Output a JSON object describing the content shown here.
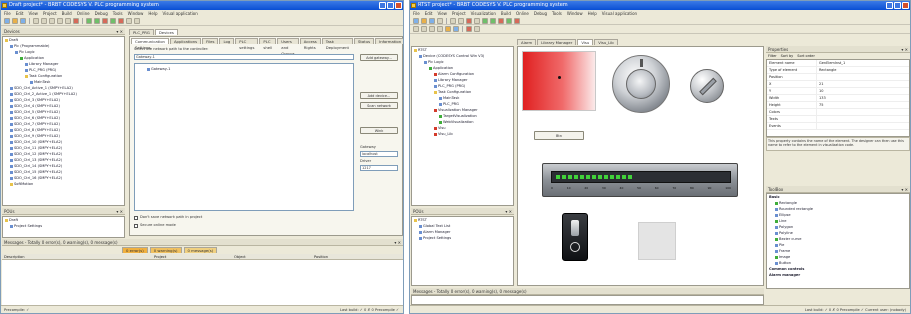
{
  "left_window": {
    "title": "Draft project* - BRBT CODESYS V. PLC programming system",
    "menu": [
      "File",
      "Edit",
      "View",
      "Project",
      "Build",
      "Online",
      "Debug",
      "Tools",
      "Window",
      "Help",
      "Visual application"
    ],
    "devices_pane": {
      "title": "Devices",
      "close": "▾ ✕"
    },
    "tree": [
      {
        "label": "Draft",
        "level": 0,
        "icon": "yellow"
      },
      {
        "label": "Plc (Programmable)",
        "level": 1,
        "icon": "blue"
      },
      {
        "label": "Plc Logic",
        "level": 2,
        "icon": "blue"
      },
      {
        "label": "Application",
        "level": 3,
        "icon": "green"
      },
      {
        "label": "Library Manager",
        "level": 4,
        "icon": "blue"
      },
      {
        "label": "PLC_PRG (PRG)",
        "level": 4,
        "icon": "blue"
      },
      {
        "label": "Task Configuration",
        "level": 4,
        "icon": "yellow"
      },
      {
        "label": "MainTask",
        "level": 5,
        "icon": "blue"
      },
      {
        "label": "SDO_Ctrl_Active_1 (SMPY+ELA2)",
        "level": 1,
        "icon": "blue"
      },
      {
        "label": "SDO_Ctrl_2_Active_1 (SMPY+ELA2)",
        "level": 1,
        "icon": "blue"
      },
      {
        "label": "SDO_Ctrl_3 (SMPY+ELA2)",
        "level": 1,
        "icon": "blue"
      },
      {
        "label": "SDO_Ctrl_4 (SMPY+ELA2)",
        "level": 1,
        "icon": "blue"
      },
      {
        "label": "SDO_Ctrl_5 (SMPY+ELA2)",
        "level": 1,
        "icon": "blue"
      },
      {
        "label": "SDO_Ctrl_6 (SMPY+ELA2)",
        "level": 1,
        "icon": "blue"
      },
      {
        "label": "SDO_Ctrl_7 (SMPY+ELA2)",
        "level": 1,
        "icon": "blue"
      },
      {
        "label": "SDO_Ctrl_8 (SMPY+ELA2)",
        "level": 1,
        "icon": "blue"
      },
      {
        "label": "SDO_Ctrl_9 (SMPY+ELA2)",
        "level": 1,
        "icon": "blue"
      },
      {
        "label": "SDO_Ctrl_10 (SMPY+ELA2)",
        "level": 1,
        "icon": "blue"
      },
      {
        "label": "SDO_Ctrl_11 (SMPY+ELA2)",
        "level": 1,
        "icon": "blue"
      },
      {
        "label": "SDO_Ctrl_12 (SMPY+ELA2)",
        "level": 1,
        "icon": "blue"
      },
      {
        "label": "SDO_Ctrl_13 (SMPY+ELA2)",
        "level": 1,
        "icon": "blue"
      },
      {
        "label": "SDO_Ctrl_14 (SMPY+ELA2)",
        "level": 1,
        "icon": "blue"
      },
      {
        "label": "SDO_Ctrl_15 (SMPY+ELA2)",
        "level": 1,
        "icon": "blue"
      },
      {
        "label": "SDO_Ctrl_16 (SMPY+ELA2)",
        "level": 1,
        "icon": "blue"
      },
      {
        "label": "SoftMotion",
        "level": 1,
        "icon": "yellow"
      }
    ],
    "pou_pane": {
      "title": "POUs",
      "items": [
        "Draft",
        "Project Settings"
      ]
    },
    "editor_tabs": [
      "PLC_PRG",
      "Devices"
    ],
    "sub_tabs": [
      "Communication Settings",
      "Applications",
      "Files",
      "Log",
      "PLC settings",
      "PLC shell",
      "Users and Groups",
      "Access Rights",
      "Task Deployment",
      "Status",
      "Information"
    ],
    "select_label": "Select the network path to the controller:",
    "gateway_value": "Gateway-1",
    "tree_node": "Gateway-1",
    "buttons": [
      "Add gateway...",
      "Add device...",
      "Scan network",
      "Wink"
    ],
    "right_labels": {
      "gateway": "Gateway",
      "ip": "localhost",
      "port": "1217",
      "driver": "Driver"
    },
    "checkboxes": [
      "Don't save network path in project",
      "Secure online mode"
    ],
    "messages": {
      "title": "Messages - Totally 0 error(s), 0 warning(s), 0 message(s)",
      "tabs": [
        "0 error(s)",
        "0 warning(s)",
        "0 message(s)"
      ],
      "columns": [
        "Description",
        "Project",
        "Object",
        "Position"
      ]
    },
    "status": {
      "left": "Precompile: ✓",
      "right": "Last build: ✓ 0 ✗ 0   Precompile ✓"
    }
  },
  "right_window": {
    "title": "RTST project* - BRBT CODESYS V. PLC programming system",
    "menu": [
      "File",
      "Edit",
      "View",
      "Project",
      "Visualization",
      "Build",
      "Online",
      "Debug",
      "Tools",
      "Window",
      "Help",
      "Visual application"
    ],
    "tree": [
      {
        "label": "RTST",
        "level": 0,
        "icon": "yellow"
      },
      {
        "label": "Device (CODESYS Control Win V3)",
        "level": 1,
        "icon": "blue"
      },
      {
        "label": "Plc Logic",
        "level": 2,
        "icon": "blue"
      },
      {
        "label": "Application",
        "level": 3,
        "icon": "green"
      },
      {
        "label": "Alarm Configuration",
        "level": 4,
        "icon": "red"
      },
      {
        "label": "Library Manager",
        "level": 4,
        "icon": "blue"
      },
      {
        "label": "PLC_PRG (PRG)",
        "level": 4,
        "icon": "blue"
      },
      {
        "label": "Task Configuration",
        "level": 4,
        "icon": "yellow"
      },
      {
        "label": "MainTask",
        "level": 5,
        "icon": "blue"
      },
      {
        "label": "PLC_PRG",
        "level": 5,
        "icon": "blue"
      },
      {
        "label": "Visualization Manager",
        "level": 4,
        "icon": "red"
      },
      {
        "label": "TargetVisualization",
        "level": 5,
        "icon": "green"
      },
      {
        "label": "WebVisualization",
        "level": 5,
        "icon": "green"
      },
      {
        "label": "Visu",
        "level": 4,
        "icon": "red"
      },
      {
        "label": "Visu_Lib",
        "level": 4,
        "icon": "red"
      }
    ],
    "pou_pane": {
      "title": "POUs",
      "items": [
        "RTST",
        "Global Text List",
        "Alarm Manager",
        "Project Settings"
      ]
    },
    "editor_tabs": [
      "Alarm",
      "Library Manager",
      "Visu",
      "Visu_Lib"
    ],
    "gauge_button_label": "Btn",
    "slider_ticks": [
      "0",
      "10",
      "20",
      "30",
      "40",
      "50",
      "60",
      "70",
      "80",
      "90",
      "100"
    ],
    "properties": {
      "title": "Properties",
      "toolbar": [
        "Filter",
        "Sort by",
        "Sort order"
      ],
      "rows": [
        "Element name",
        "Type of element",
        "Position",
        "X",
        "Y",
        "Width",
        "Height",
        "Colors",
        "Texts",
        "Events"
      ],
      "values": [
        "GenElemInst_1",
        "Rectangle",
        "",
        "21",
        "10",
        "133",
        "75",
        "",
        "",
        ""
      ],
      "description": "This property contains the name of the element. The designer can then use this name to refer to the element in visualization code."
    },
    "toolbox": {
      "title": "ToolBox",
      "section": "Basic",
      "items": [
        "Rectangle",
        "Rounded rectangle",
        "Ellipse",
        "Line",
        "Polygon",
        "Polyline",
        "Bezier curve",
        "Pie",
        "Frame",
        "Image",
        "Button"
      ],
      "section2": "Common controls",
      "section3": "Alarm manager"
    },
    "messages_title": "Messages - Totally 0 error(s), 0 warning(s), 0 message(s)",
    "status": {
      "left": "",
      "right": "Last build: ✓ 0 ✗ 0   Precompile ✓   Current user: (nobody)"
    }
  },
  "colors": {
    "titlebar": "#0a4fd4",
    "chrome": "#ece9d8",
    "red_gradient": "#e02a2a",
    "slider_green": "#41d13a"
  }
}
